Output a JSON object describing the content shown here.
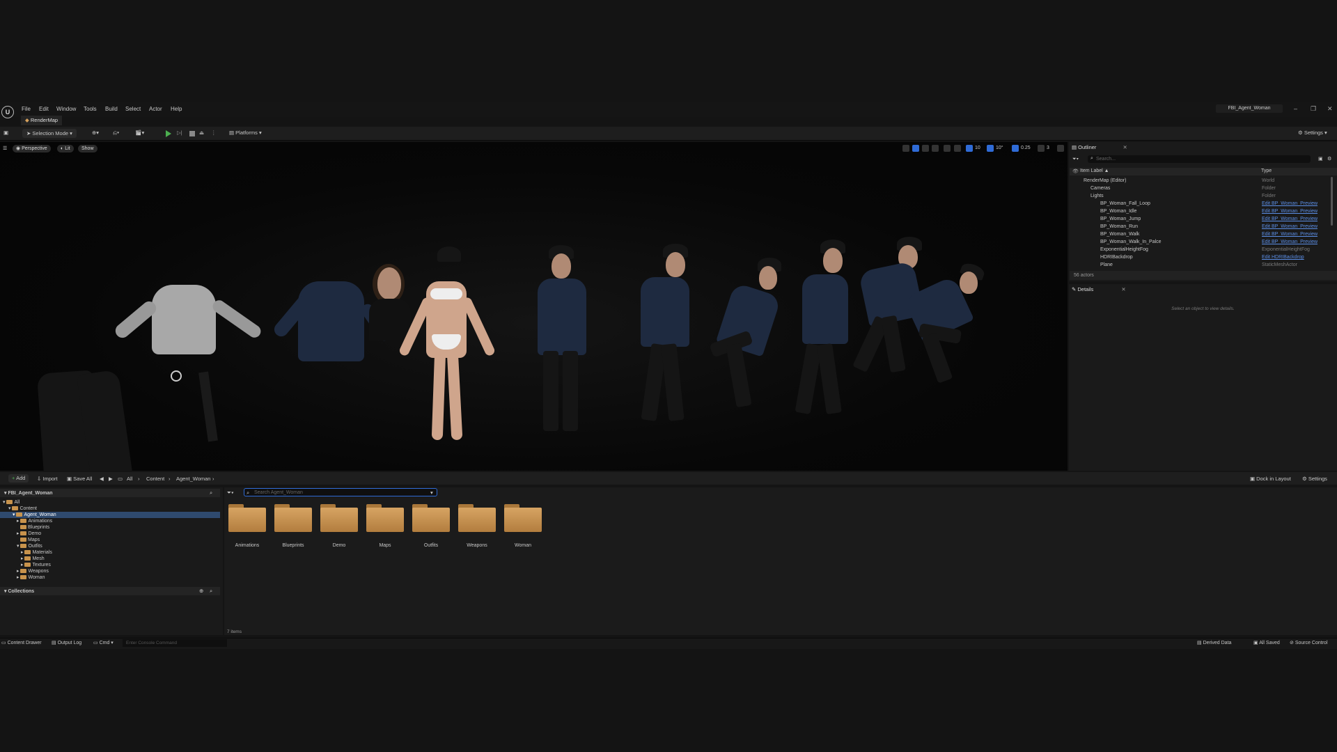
{
  "menu": {
    "items": [
      "File",
      "Edit",
      "Window",
      "Tools",
      "Build",
      "Select",
      "Actor",
      "Help"
    ]
  },
  "app": {
    "logo": "U",
    "map_tab": "RenderMap",
    "window_title": "FBI_Agent_Woman"
  },
  "toolbar": {
    "selection_mode": "Selection Mode",
    "platforms": "Platforms",
    "settings": "Settings"
  },
  "viewport": {
    "perspective": "Perspective",
    "lit": "Lit",
    "show": "Show",
    "grid_snap": "10",
    "angle_snap": "10°",
    "scale_snap": "0.25",
    "camera_speed": "3"
  },
  "outliner": {
    "title": "Outliner",
    "search_placeholder": "Search...",
    "col_label": "Item Label ▲",
    "col_type": "Type",
    "rows": [
      {
        "label": "RenderMap (Editor)",
        "type": "World"
      },
      {
        "label": "Cameras",
        "type": "Folder"
      },
      {
        "label": "Lights",
        "type": "Folder"
      },
      {
        "label": "BP_Woman_Fall_Loop",
        "type": "Edit BP_Woman_Preview"
      },
      {
        "label": "BP_Woman_Idle",
        "type": "Edit BP_Woman_Preview"
      },
      {
        "label": "BP_Woman_Jump",
        "type": "Edit BP_Woman_Preview"
      },
      {
        "label": "BP_Woman_Run",
        "type": "Edit BP_Woman_Preview"
      },
      {
        "label": "BP_Woman_Walk",
        "type": "Edit BP_Woman_Preview"
      },
      {
        "label": "BP_Woman_Walk_In_Palce",
        "type": "Edit BP_Woman_Preview"
      },
      {
        "label": "ExponentialHeightFog",
        "type": "ExponentialHeightFog"
      },
      {
        "label": "HDRIBackdrop",
        "type": "Edit HDRIBackdrop"
      },
      {
        "label": "Plane",
        "type": "StaticMeshActor"
      }
    ],
    "actor_count": "56 actors"
  },
  "details": {
    "title": "Details",
    "empty_text": "Select an object to view details."
  },
  "content": {
    "add": "Add",
    "import": "Import",
    "save_all": "Save All",
    "breadcrumb": [
      "All",
      "Content",
      "Agent_Woman"
    ],
    "dock": "Dock in Layout",
    "settings": "Settings",
    "search_placeholder": "Search Agent_Woman",
    "item_count": "7 items",
    "collections": "Collections",
    "tree": [
      {
        "label": "FBI_Agent_Woman",
        "depth": 0
      },
      {
        "label": "All",
        "depth": 0
      },
      {
        "label": "Content",
        "depth": 1
      },
      {
        "label": "Agent_Woman",
        "depth": 2
      },
      {
        "label": "Animations",
        "depth": 3
      },
      {
        "label": "Blueprints",
        "depth": 3
      },
      {
        "label": "Demo",
        "depth": 3
      },
      {
        "label": "Maps",
        "depth": 3
      },
      {
        "label": "Outfits",
        "depth": 3
      },
      {
        "label": "Materials",
        "depth": 4
      },
      {
        "label": "Mesh",
        "depth": 4
      },
      {
        "label": "Textures",
        "depth": 4
      },
      {
        "label": "Weapons",
        "depth": 3
      },
      {
        "label": "Woman",
        "depth": 3
      }
    ],
    "folders": [
      "Animations",
      "Blueprints",
      "Demo",
      "Maps",
      "Outfits",
      "Weapons",
      "Woman"
    ]
  },
  "statusbar": {
    "content_drawer": "Content Drawer",
    "output_log": "Output Log",
    "cmd": "Cmd",
    "console_placeholder": "Enter Console Command",
    "derived_data": "Derived Data",
    "all_saved": "All Saved",
    "source_control": "Source Control"
  },
  "colors": {
    "accent": "#2f6bd6",
    "folder": "#c8934c",
    "link": "#5b8ee6"
  }
}
